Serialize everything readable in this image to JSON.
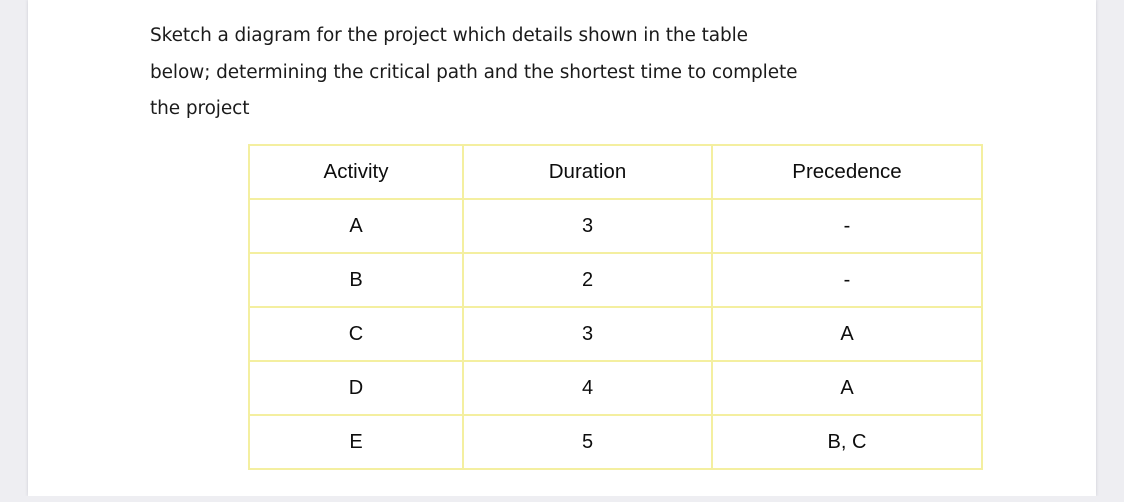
{
  "document": {
    "question": {
      "lines": [
        "Sketch a diagram for the project which details shown in the table",
        "below; determining the critical path and the shortest time to complete",
        "the project"
      ]
    },
    "table": {
      "headers": [
        "Activity",
        "Duration",
        "Precedence"
      ],
      "rows": [
        {
          "activity": "A",
          "duration": "3",
          "precedence": "-"
        },
        {
          "activity": "B",
          "duration": "2",
          "precedence": "-"
        },
        {
          "activity": "C",
          "duration": "3",
          "precedence": "A"
        },
        {
          "activity": "D",
          "duration": "4",
          "precedence": "A"
        },
        {
          "activity": "E",
          "duration": "5",
          "precedence": "B, C"
        }
      ]
    }
  },
  "colors": {
    "table_border": "#f4efa0",
    "page_background": "#ffffff",
    "canvas_background": "#eeeef2",
    "text": "#0d0d0d"
  }
}
